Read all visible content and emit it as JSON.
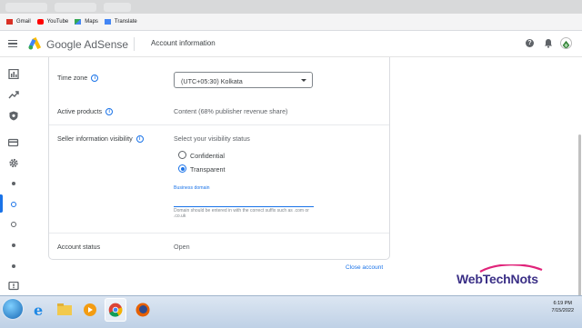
{
  "browser": {
    "bookmarks": [
      {
        "label": "Gmail",
        "icon": "gmail-icon",
        "color": "#d93025"
      },
      {
        "label": "YouTube",
        "icon": "youtube-icon",
        "color": "#ff0000"
      },
      {
        "label": "Maps",
        "icon": "maps-icon",
        "color": "#34a853"
      },
      {
        "label": "Translate",
        "icon": "translate-icon",
        "color": "#4285f4"
      }
    ]
  },
  "header": {
    "brand": "Google AdSense",
    "title": "Account information"
  },
  "form": {
    "timezone": {
      "label": "Time zone",
      "value": "(UTC+05:30) Kolkata"
    },
    "active_products": {
      "label": "Active products",
      "value": "Content (68% publisher revenue share)"
    },
    "seller_visibility": {
      "label": "Seller information visibility",
      "prompt": "Select your visibility status",
      "options": [
        "Confidential",
        "Transparent"
      ],
      "selected": "Transparent",
      "domain_label": "Business domain",
      "domain_value": "",
      "domain_hint": "Domain should be entered in with the correct suffix such as .com or .co.uk"
    },
    "account_status": {
      "label": "Account status",
      "value": "Open"
    }
  },
  "close_account": "Close account",
  "watermark": "WebTechNots",
  "taskbar": {
    "time": "6:19 PM",
    "date": "7/15/2022"
  },
  "colors": {
    "accent": "#1a73e8",
    "adsense_yellow": "#fbbc04"
  }
}
